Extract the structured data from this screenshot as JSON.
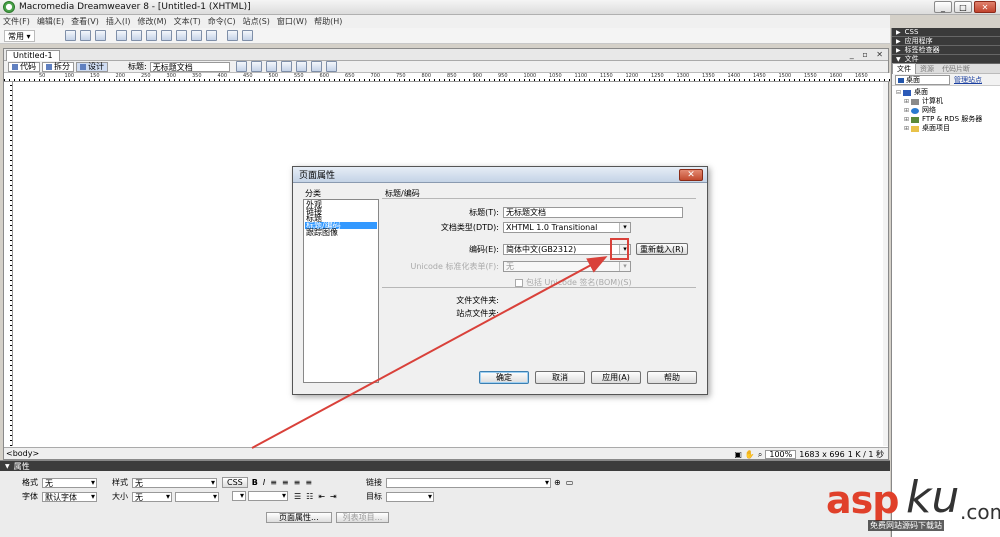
{
  "window": {
    "title": "Macromedia Dreamweaver 8 - [Untitled-1 (XHTML)]",
    "controls": [
      "_",
      "□",
      "✕"
    ]
  },
  "menu": [
    "文件(F)",
    "编辑(E)",
    "查看(V)",
    "插入(I)",
    "修改(M)",
    "文本(T)",
    "命令(C)",
    "站点(S)",
    "窗口(W)",
    "帮助(H)"
  ],
  "insert_bar": {
    "category": "常用 ▾"
  },
  "panels": {
    "headers": [
      "CSS",
      "应用程序",
      "标签检查器",
      "文件"
    ],
    "tabs": [
      "文件",
      "资源",
      "代码片断"
    ],
    "site_select": "桌面",
    "site_link": "管理站点",
    "tree": [
      "桌面",
      "计算机",
      "网络",
      "FTP & RDS 服务器",
      "桌面项目"
    ]
  },
  "document": {
    "tab": "Untitled-1",
    "view_buttons": [
      "代码",
      "拆分",
      "设计"
    ],
    "title_label": "标题:",
    "title_value": "无标题文档",
    "ruler_ticks": [
      "50",
      "100",
      "150",
      "200",
      "250",
      "300",
      "350",
      "400",
      "450",
      "500",
      "550",
      "600",
      "650",
      "700",
      "750",
      "800",
      "850",
      "900",
      "950",
      "1000",
      "1050",
      "1100",
      "1150",
      "1200",
      "1250",
      "1300",
      "1350",
      "1400",
      "1450",
      "1500",
      "1550",
      "1600",
      "1650"
    ],
    "status_tag": "<body>",
    "zoom": "100%",
    "size": "1683 x 696",
    "file_info": "1 K / 1 秒"
  },
  "properties": {
    "header": "属性",
    "format_label": "格式",
    "format_value": "无",
    "style_label": "样式",
    "style_value": "无",
    "css_button": "CSS",
    "link_label": "链接",
    "font_label": "字体",
    "font_value": "默认字体",
    "size_label": "大小",
    "size_value": "无",
    "target_label": "目标",
    "page_props_button": "页面属性...",
    "list_item_button": "列表项目..."
  },
  "dialog": {
    "title": "页面属性",
    "close": "✕",
    "category_label": "分类",
    "categories": [
      "外观",
      "链接",
      "标题",
      "标题/编码",
      "跟踪图像"
    ],
    "selected_category": 3,
    "section": "标题/编码",
    "title_label": "标题(T):",
    "title_value": "无标题文档",
    "doctype_label": "文档类型(DTD):",
    "doctype_value": "XHTML 1.0 Transitional",
    "encoding_label": "编码(E):",
    "encoding_value": "简体中文(GB2312)",
    "reload_button": "重新载入(R)",
    "unicode_label": "Unicode 标准化表单(F):",
    "unicode_value": "无",
    "bom_label": "包括 Unicode 签名(BOM)(S)",
    "doc_folder_label": "文件文件夹:",
    "site_folder_label": "站点文件夹:",
    "buttons": [
      "确定",
      "取消",
      "应用(A)",
      "帮助"
    ]
  },
  "watermark": {
    "asp": "asp",
    "ku": "ku",
    "dot": ".com",
    "sub": "免费网站源码下载站"
  }
}
